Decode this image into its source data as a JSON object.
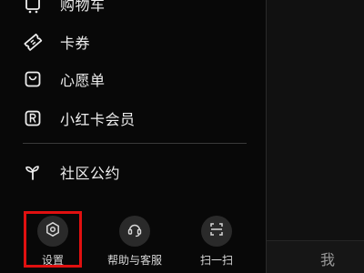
{
  "drawer": {
    "items": [
      {
        "label": "购物车",
        "icon": "shopping-cart-icon"
      },
      {
        "label": "卡券",
        "icon": "ticket-icon"
      },
      {
        "label": "心愿单",
        "icon": "wishlist-bag-icon"
      },
      {
        "label": "小红卡会员",
        "icon": "registered-member-icon"
      },
      {
        "label": "社区公约",
        "icon": "sprout-icon"
      }
    ],
    "bottom_buttons": [
      {
        "label": "设置",
        "icon": "gear-icon"
      },
      {
        "label": "帮助与客服",
        "icon": "headset-icon"
      },
      {
        "label": "扫一扫",
        "icon": "scan-icon"
      }
    ]
  },
  "tabbar": {
    "me_label": "我"
  },
  "colors": {
    "background": "#000000",
    "drawer": "#080808",
    "button_circle": "#2a2a2a",
    "highlight": "#e01010"
  }
}
